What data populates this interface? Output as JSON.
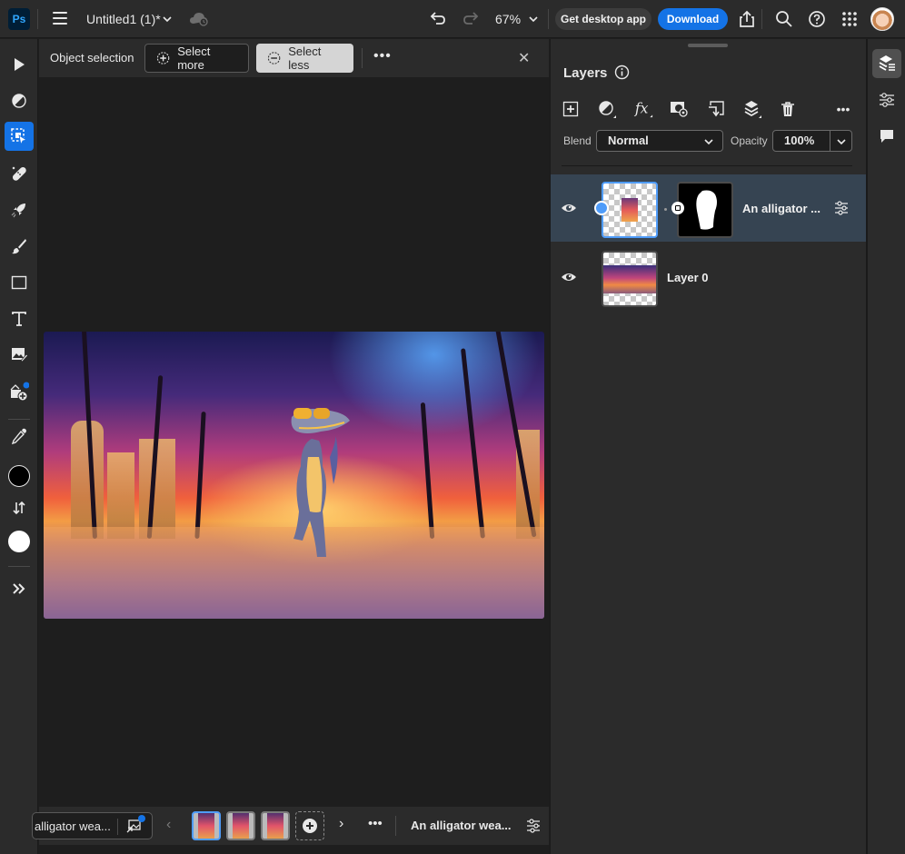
{
  "app": {
    "logo": "Ps",
    "document_title": "Untitled1 (1)*",
    "zoom_level": "67%",
    "get_desktop_label": "Get desktop app",
    "download_label": "Download",
    "icons": [
      "menu-icon",
      "chevron-down-icon",
      "cloud-sync-icon",
      "undo-icon",
      "redo-icon",
      "share-icon",
      "search-icon",
      "help-icon",
      "apps-grid-icon",
      "avatar"
    ]
  },
  "toolbar": {
    "tools": [
      {
        "name": "move-tool",
        "icon": "arrow-pointer-icon",
        "active": false
      },
      {
        "name": "adjust-tool",
        "icon": "half-circle-icon",
        "active": false
      },
      {
        "name": "object-selection-tool",
        "icon": "object-selection-icon",
        "active": true
      },
      {
        "name": "healing-tool",
        "icon": "bandage-icon",
        "active": false
      },
      {
        "name": "quick-actions-tool",
        "icon": "rocket-icon",
        "active": false
      },
      {
        "name": "brush-tool",
        "icon": "brush-icon",
        "active": false
      },
      {
        "name": "shape-tool",
        "icon": "rectangle-icon",
        "active": false
      },
      {
        "name": "type-tool",
        "icon": "text-icon",
        "active": false
      },
      {
        "name": "place-image-tool",
        "icon": "image-edit-icon",
        "active": false
      },
      {
        "name": "generative-fill-tool",
        "icon": "image-add-icon",
        "active": false
      },
      {
        "name": "eyedropper-tool",
        "icon": "eyedropper-icon",
        "active": false
      }
    ],
    "foreground_color": "#000000",
    "background_color": "#ffffff"
  },
  "options_bar": {
    "tool_label": "Object selection",
    "select_more_label": "Select more",
    "select_less_label": "Select less",
    "more_label": "•••",
    "close_label": "✕"
  },
  "taskbar": {
    "prompt_text": "alligator wea...",
    "variations_count": 3,
    "selected_variation": 1,
    "prev_label": "‹",
    "next_label": "›",
    "more_label": "•••",
    "title": "An alligator wea..."
  },
  "layers_panel": {
    "title": "Layers",
    "blend_label": "Blend",
    "blend_value": "Normal",
    "opacity_label": "Opacity",
    "opacity_value": "100%",
    "more_label": "•••",
    "layers": [
      {
        "name": "An alligator ...",
        "visible": true,
        "selected": true,
        "has_mask": true
      },
      {
        "name": "Layer 0",
        "visible": true,
        "selected": false,
        "has_mask": false
      }
    ]
  },
  "right_rail": {
    "items": [
      {
        "name": "layers",
        "active": true
      },
      {
        "name": "adjustments",
        "active": false
      },
      {
        "name": "comments",
        "active": false
      }
    ]
  },
  "colors": {
    "accent": "#1473e6",
    "selection_blue": "#4f9cf9",
    "panel_bg": "#2b2b2b",
    "canvas_bg": "#1e1e1e",
    "selected_layer_bg": "#364452"
  }
}
